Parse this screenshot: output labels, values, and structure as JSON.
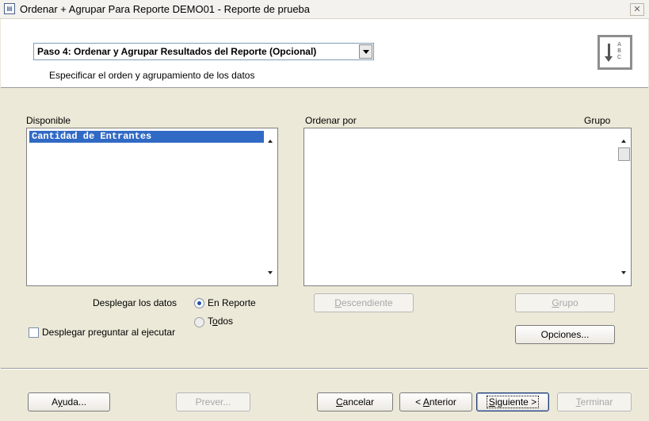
{
  "window": {
    "title": "Ordenar + Agrupar Para Reporte DEMO01 - Reporte de prueba",
    "close_glyph": "✕",
    "app_icon": "report-icon"
  },
  "header": {
    "step_select_value": "Paso 4: Ordenar y Agrupar Resultados del Reporte (Opcional)",
    "description": "Especificar el orden y agrupamiento de los datos",
    "logo_icon": "sort-ascending-icon",
    "logo_letters": "A B C"
  },
  "available": {
    "label": "Disponible",
    "items": [
      "Cantidad de Entrantes"
    ],
    "selected_index": 0
  },
  "order_by": {
    "label": "Ordenar por",
    "group_label": "Grupo",
    "items": []
  },
  "display": {
    "label": "Desplegar los datos",
    "options": [
      "En Reporte",
      "Todos"
    ],
    "selected": "En Reporte"
  },
  "prompt_checkbox": {
    "label": "Desplegar preguntar al ejecutar",
    "checked": false
  },
  "middle_buttons": {
    "descending": "Descendiente",
    "group": "Grupo",
    "options": "Opciones..."
  },
  "footer": {
    "help": "Ayuda...",
    "preview": "Prever...",
    "cancel": "Cancelar",
    "previous": "< Anterior",
    "next": "Siguiente >",
    "finish": "Terminar"
  }
}
